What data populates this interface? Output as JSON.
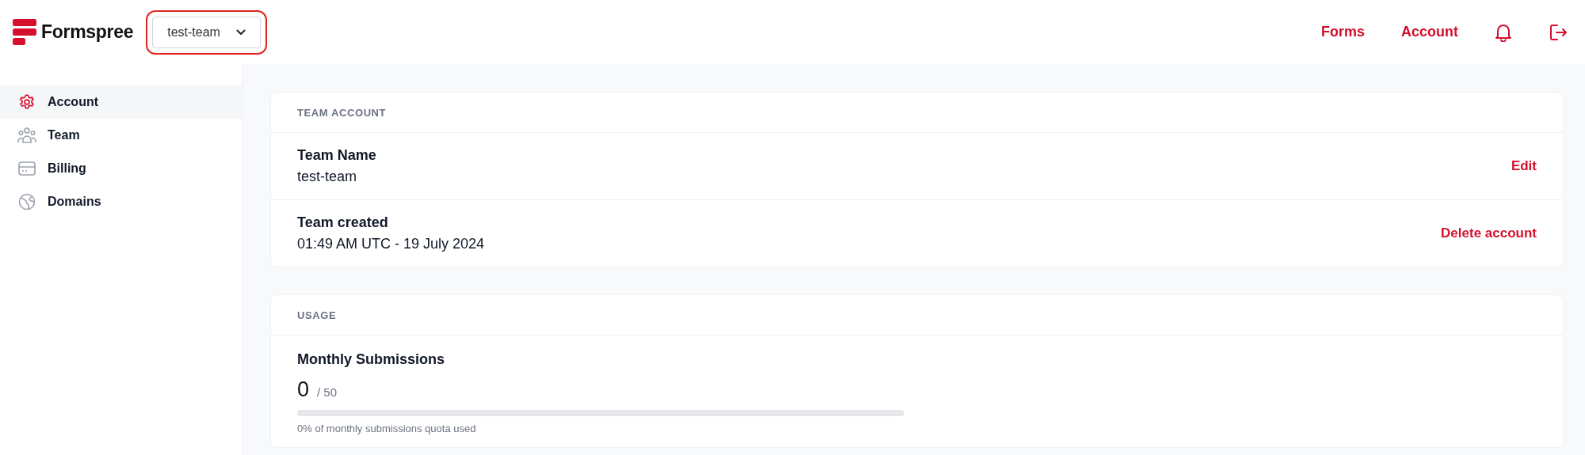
{
  "header": {
    "logo": "Formspree",
    "team_selector": {
      "value": "test-team",
      "focused": true
    },
    "nav": [
      {
        "kind": "link",
        "label": "Forms"
      },
      {
        "kind": "link",
        "label": "Account"
      },
      {
        "kind": "bell"
      },
      {
        "kind": "logout"
      }
    ]
  },
  "sidebar": {
    "items": [
      {
        "kind": "gear",
        "label": "Account",
        "selected": true
      },
      {
        "kind": "team",
        "label": "Team",
        "selected": false
      },
      {
        "kind": "card",
        "label": "Billing",
        "selected": false
      },
      {
        "kind": "globe",
        "label": "Domains",
        "selected": false
      }
    ]
  },
  "cards": [
    {
      "title": "TEAM ACCOUNT",
      "kind": "fields",
      "rows": [
        {
          "label": "Team Name",
          "value": "test-team",
          "action": "Edit"
        },
        {
          "label": "Team created",
          "value": "01:49 AM UTC - 19 July 2024",
          "action": "Delete account"
        }
      ]
    },
    {
      "title": "USAGE",
      "kind": "usage",
      "usage": {
        "label": "Monthly Submissions",
        "count": "0",
        "limit": "/ 50",
        "level": 0,
        "caption": "0% of monthly submissions quota used"
      }
    }
  ]
}
